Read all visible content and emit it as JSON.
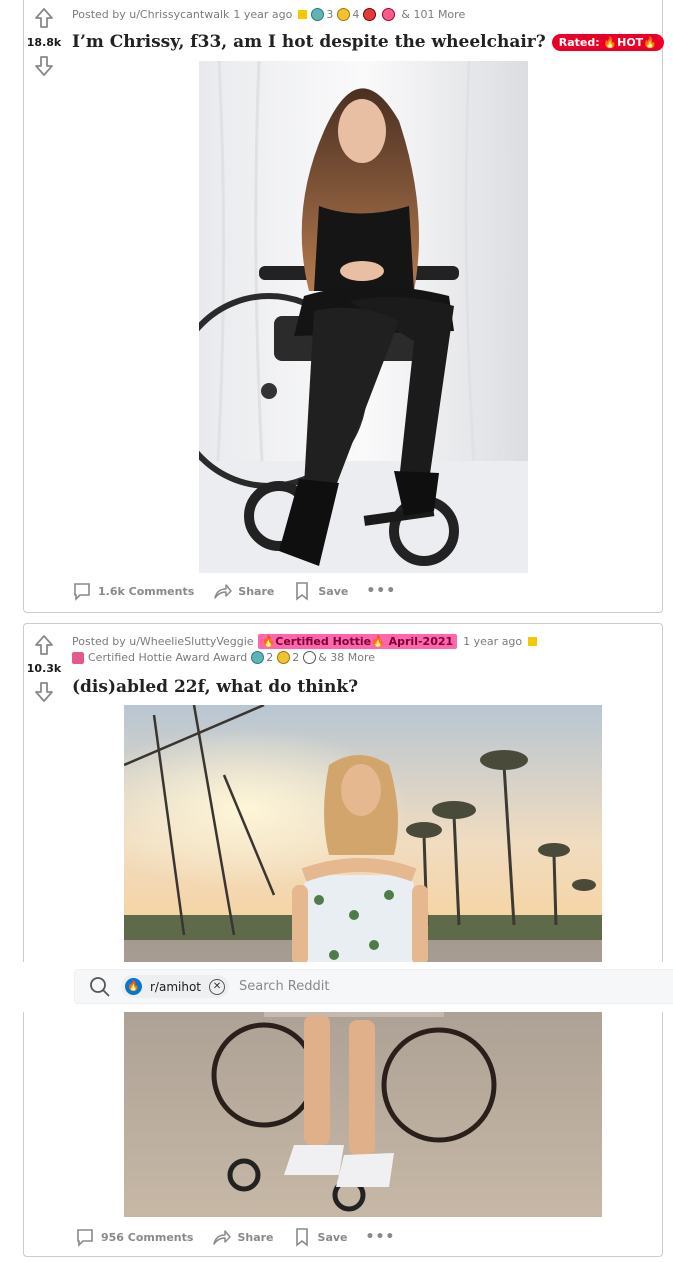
{
  "search": {
    "subreddit_chip": "r/amihot",
    "placeholder": "Search Reddit"
  },
  "posts": [
    {
      "score": "18.8k",
      "posted_by": "Posted by u/Chrissycantwalk",
      "time": "1 year ago",
      "awards": [
        {
          "count": "3"
        },
        {
          "count": "4"
        }
      ],
      "more_awards": "& 101 More",
      "title": "I’m Chrissy, f33, am I hot despite the wheelchair?",
      "flair": "Rated: 🔥HOT🔥",
      "comments": "1.6k Comments",
      "share": "Share",
      "save": "Save",
      "image_alt": "Woman with long wavy hair in black dress seated in a wheelchair against white curtain"
    },
    {
      "score": "10.3k",
      "posted_by": "Posted by u/WheelieSluttyVeggie",
      "user_flair": "🔥Certified Hottie🔥 April-2021",
      "time": "1 year ago",
      "award_name": "Certified Hottie Award Award",
      "awards": [
        {
          "count": "2"
        },
        {
          "count": "2"
        }
      ],
      "more_awards": "& 38 More",
      "title": "(dis)abled 22f, what do think?",
      "comments": "956 Comments",
      "share": "Share",
      "save": "Save",
      "image_alt": "Woman in floral strapless dress seated in a wheelchair on a boardwalk with palm trees at sunset"
    }
  ]
}
